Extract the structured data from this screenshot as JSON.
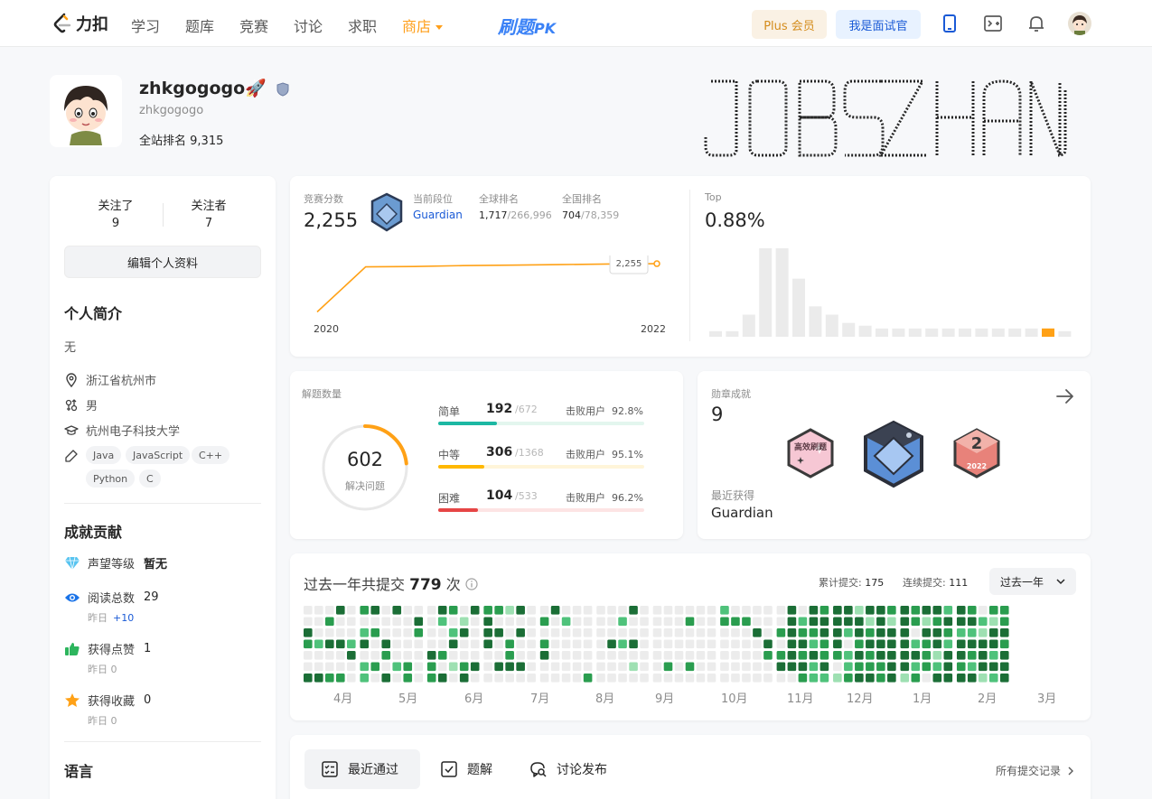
{
  "nav": {
    "logo_text": "力扣",
    "items": [
      "学习",
      "题库",
      "竞赛",
      "讨论",
      "求职"
    ],
    "store": "商店",
    "pk_main": "刷题",
    "pk_suffix": "PK",
    "plus": "Plus 会员",
    "interviewer": "我是面试官"
  },
  "profile": {
    "username": "zhkgogogo🚀",
    "handle": "zhkgogogo",
    "rank_label": "全站排名",
    "rank_value": "9,315"
  },
  "sidebar": {
    "following_label": "关注了",
    "following": "9",
    "followers_label": "关注者",
    "followers": "7",
    "edit_label": "编辑个人资料",
    "bio_title": "个人简介",
    "bio": "无",
    "location": "浙江省杭州市",
    "gender": "男",
    "school": "杭州电子科技大学",
    "tags": [
      "Java",
      "JavaScript",
      "C++",
      "Python",
      "C"
    ],
    "ach_title": "成就贡献",
    "reputation_label": "声望等级",
    "reputation_value": "暂无",
    "reads_label": "阅读总数",
    "reads_value": "29",
    "yesterday_label": "昨日",
    "reads_yesterday": "+10",
    "likes_label": "获得点赞",
    "likes_value": "1",
    "likes_yesterday": "0",
    "favs_label": "获得收藏",
    "favs_value": "0",
    "favs_yesterday": "0",
    "lang_title": "语言"
  },
  "contest": {
    "score_label": "竞赛分数",
    "score": "2,255",
    "tier_label": "当前段位",
    "tier": "Guardian",
    "global_label": "全球排名",
    "global_rank": "1,717",
    "global_total": "/266,996",
    "national_label": "全国排名",
    "national_rank": "704",
    "national_total": "/78,359",
    "top_label": "Top",
    "top_value": "0.88%",
    "rating_tooltip": "2,255",
    "year_start": "2020",
    "year_end": "2022"
  },
  "chart_data": [
    {
      "type": "line",
      "x": [
        "2020",
        "2020",
        "2020",
        "2021",
        "2021",
        "2022",
        "2022",
        "2022"
      ],
      "y": [
        1500,
        2205,
        2210,
        2225,
        2232,
        2240,
        2250,
        2255
      ],
      "xlabel": "",
      "ylabel": "",
      "annotations": [
        "2,255"
      ]
    },
    {
      "type": "bar",
      "values": [
        2,
        2,
        8,
        32,
        32,
        21,
        11,
        8,
        5,
        4,
        3,
        3,
        3,
        3,
        3,
        3,
        3,
        3,
        3,
        3,
        3,
        2
      ],
      "highlight_index": 20,
      "xlabel": "",
      "ylabel": ""
    }
  ],
  "solved": {
    "label": "解题数量",
    "total": "602",
    "total_label": "解决问题",
    "beat_label": "击败用户",
    "rows": [
      {
        "name": "简单",
        "count": "192",
        "total": "/672",
        "beat": "92.8%",
        "frac": 0.286,
        "color": "#1cb8a3",
        "bg": "#e3f6ee"
      },
      {
        "name": "中等",
        "count": "306",
        "total": "/1368",
        "beat": "95.1%",
        "frac": 0.224,
        "color": "#ffb800",
        "bg": "#fff5d9"
      },
      {
        "name": "困难",
        "count": "104",
        "total": "/533",
        "beat": "96.2%",
        "frac": 0.195,
        "color": "#e64545",
        "bg": "#fde4e4"
      }
    ]
  },
  "badges": {
    "label": "勋章成就",
    "count": "9",
    "recent_label": "最近获得",
    "recent": "Guardian",
    "badge1": "高效刷题",
    "badge3": "2022"
  },
  "heatmap": {
    "title_prefix": "过去一年共提交",
    "total": "779",
    "title_suffix": "次",
    "cumulative_label": "累计提交:",
    "cumulative": "175",
    "streak_label": "连续提交:",
    "streak": "111",
    "range": "过去一年",
    "months": [
      "4月",
      "5月",
      "6月",
      "7月",
      "8月",
      "9月",
      "10月",
      "11月",
      "12月",
      "1月",
      "2月",
      "3月"
    ]
  },
  "tabs": {
    "recent": "最近通过",
    "solutions": "题解",
    "discuss": "讨论发布",
    "all_link": "所有提交记录"
  }
}
